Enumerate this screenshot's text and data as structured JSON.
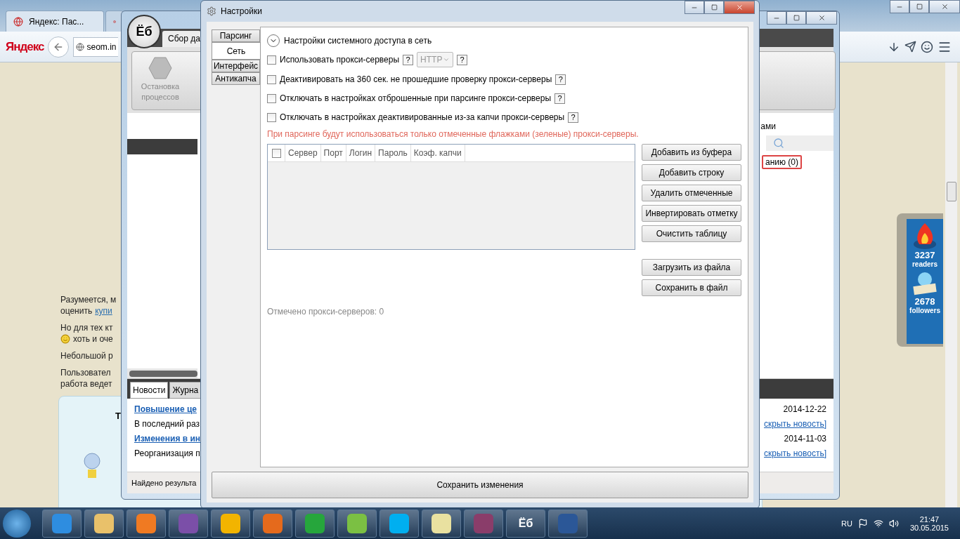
{
  "browser": {
    "tabs": [
      {
        "title": "Яндекс: Пас...",
        "selected": true
      },
      {
        "selected": false
      }
    ],
    "logo": "Яндекс",
    "url": "seom.in",
    "paragraphs": [
      {
        "lines": [
          {
            "text": "Разумеется, м"
          },
          {
            "text": "оценить",
            "link": "купи"
          }
        ]
      },
      {
        "lines": [
          {
            "text": "Но для тех кт"
          },
          {
            "text": "хоть и оче",
            "smiley": true
          }
        ]
      },
      {
        "lines": [
          {
            "text": "Небольшой р"
          }
        ]
      },
      {
        "lines": [
          {
            "text": "Пользовател"
          },
          {
            "text": "работа ведет"
          }
        ]
      }
    ],
    "tip_title": "Т",
    "widget": {
      "readers_count": "3237",
      "readers_label": "readers",
      "followers_count": "2678",
      "followers_label": "followers"
    }
  },
  "app": {
    "logo": "Ёб",
    "tab": "Сбор да",
    "ribbon": [
      {
        "lines": [
          "Остановка",
          "процессов"
        ]
      }
    ],
    "heading": "ами",
    "filter_button": "анию (0)",
    "bottom_tabs": [
      {
        "label": "Новости",
        "selected": true
      },
      {
        "label": "Журна",
        "selected": false
      }
    ],
    "news": [
      {
        "title": "Повышение це",
        "date": "2014-12-22",
        "text": "В последний раз",
        "hide": "скрыть новость]"
      },
      {
        "title": "Изменения в ин",
        "date": "2014-11-03",
        "text": "Реорганизация п",
        "hide": "скрыть новость]"
      }
    ],
    "status": "Найдено результа"
  },
  "dialog": {
    "title": "Настройки",
    "tabs": [
      {
        "label": "Парсинг",
        "selected": false
      },
      {
        "label": "Сеть",
        "selected": true
      },
      {
        "label": "Интерфейс",
        "selected": false
      },
      {
        "label": "Антикапча",
        "selected": false
      }
    ],
    "section": {
      "label": "Настройки системного доступа в сеть",
      "expanded": true
    },
    "options": [
      {
        "label": "Использовать прокси-серверы",
        "checked": false,
        "help": "?",
        "protocol": "HTTP",
        "protocol_help": "?"
      },
      {
        "label": "Деактивировать на 360 сек. не прошедшие проверку прокси-серверы",
        "checked": false,
        "help": "?"
      },
      {
        "label": "Отключать в настройках отброшенные при парсинге прокси-серверы",
        "checked": false,
        "help": "?"
      },
      {
        "label": "Отключать в настройках деактивированные из-за капчи прокси-серверы",
        "checked": false,
        "help": "?"
      }
    ],
    "warning": "При парсинге будут использоваться только отмеченные флажками (зеленые) прокси-серверы.",
    "table": {
      "all_checked": false,
      "columns": [
        "Сервер",
        "Порт",
        "Логин",
        "Пароль",
        "Коэф. капчи"
      ]
    },
    "buttons": [
      {
        "label": "Добавить из буфера",
        "gap_before": false
      },
      {
        "label": "Добавить строку",
        "gap_before": false
      },
      {
        "label": "Удалить отмеченные",
        "gap_before": false
      },
      {
        "label": "Инвертировать отметку",
        "gap_before": false
      },
      {
        "label": "Очистить таблицу",
        "gap_before": false
      },
      {
        "label": "Загрузить из файла",
        "gap_before": true
      },
      {
        "label": "Сохранить в файл",
        "gap_before": false
      }
    ],
    "count": "Отмечено прокси-серверов: 0",
    "save": "Сохранить изменения"
  },
  "taskbar": {
    "apps": [
      {
        "kind": "browser"
      },
      {
        "kind": "folder"
      },
      {
        "kind": "player"
      },
      {
        "kind": "studio"
      },
      {
        "kind": "mail"
      },
      {
        "kind": "firefox"
      },
      {
        "kind": "letter"
      },
      {
        "kind": "flower"
      },
      {
        "kind": "skype"
      },
      {
        "kind": "calendar"
      },
      {
        "kind": "archive"
      },
      {
        "kind": "text",
        "label": "Ёб"
      },
      {
        "kind": "word"
      }
    ],
    "lang": "RU",
    "time": "21:47",
    "date": "30.05.2015"
  }
}
